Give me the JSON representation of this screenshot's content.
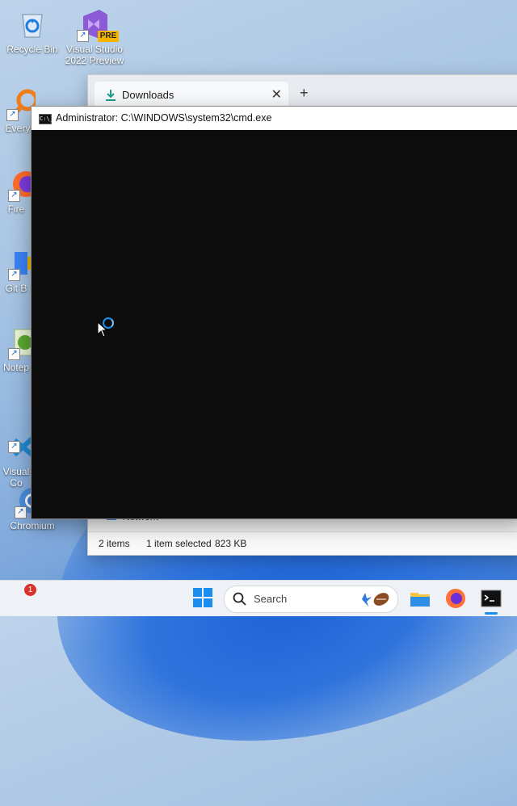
{
  "desktop": {
    "icons": [
      {
        "label": "Recycle Bin"
      },
      {
        "label": "Visual Studio 2022 Preview",
        "badge": "PRE"
      },
      {
        "label": "Every"
      },
      {
        "label": "Fire"
      },
      {
        "label": "Git B"
      },
      {
        "label": "Notep"
      },
      {
        "label": "Visual\nCo"
      },
      {
        "label": "Chromium"
      }
    ]
  },
  "explorer": {
    "tab_label": "Downloads",
    "tab_close": "✕",
    "new_tab": "+",
    "nav_item": "Network",
    "status": {
      "items": "2 items",
      "selected": "1 item selected",
      "size": "823 KB"
    }
  },
  "cmd": {
    "icon_text": "C:\\_",
    "title": "Administrator: C:\\WINDOWS\\system32\\cmd.exe"
  },
  "taskbar": {
    "search_placeholder": "Search",
    "notification_count": "1",
    "icons": [
      "weather-icon",
      "start-icon",
      "search-icon",
      "file-explorer-icon",
      "firefox-icon",
      "terminal-icon"
    ]
  },
  "colors": {
    "cmd_background": "#0c0c0c",
    "accent": "#1a8df0"
  }
}
